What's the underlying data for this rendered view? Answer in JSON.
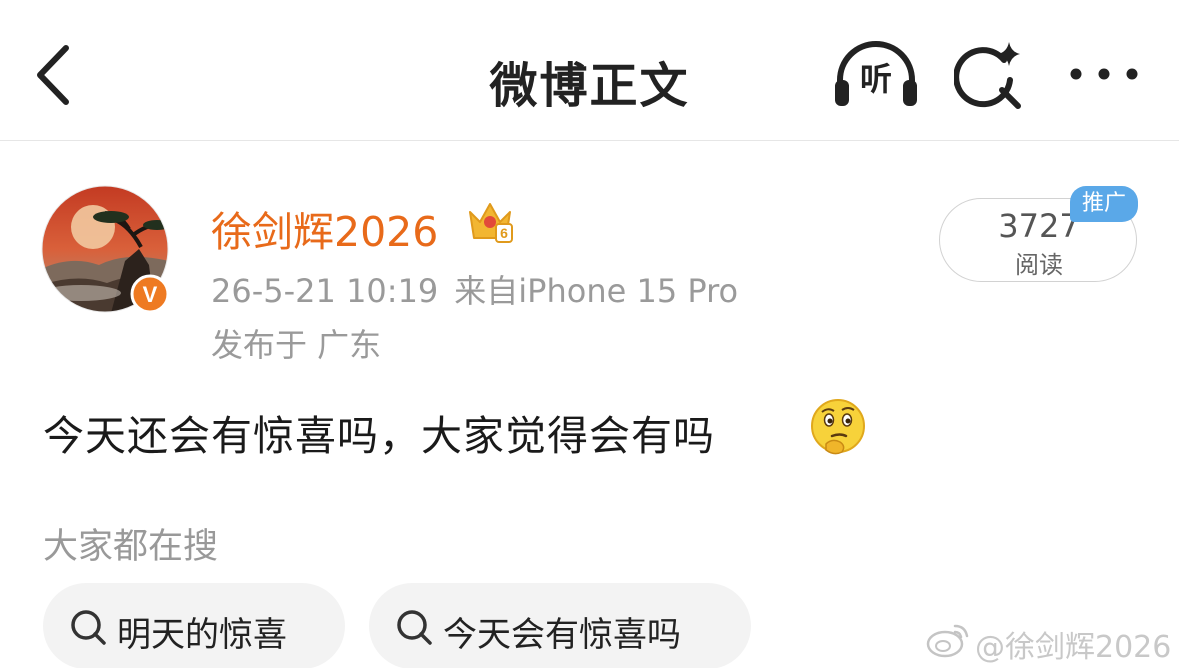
{
  "header": {
    "title": "微博正文",
    "back_icon": "chevron-left-icon",
    "listen_label": "听",
    "search_icon": "search-sparkle-icon",
    "more_icon": "more-dots-icon"
  },
  "post": {
    "author": {
      "name": "徐剑辉2026",
      "verified_badge": "V",
      "membership_badge": "crown-icon",
      "membership_level": "6"
    },
    "timestamp": "26-5-21 10:19",
    "source": "来自iPhone 15 Pro",
    "location": "发布于 广东",
    "read_count": "3727",
    "read_label": "阅读",
    "promo_badge": "推广",
    "text": "今天还会有惊喜吗，大家觉得会有吗",
    "emoji": "thinking-face-emoji"
  },
  "suggestions": {
    "label": "大家都在搜",
    "items": [
      {
        "text": "明天的惊喜",
        "icon": "search-icon"
      },
      {
        "text": "今天会有惊喜吗",
        "icon": "search-icon"
      }
    ]
  },
  "watermark": {
    "text": "@徐剑辉2026",
    "logo": "weibo-logo-icon"
  },
  "colors": {
    "username": "#e86a1a",
    "verified": "#ee7a22",
    "promo": "#5aa8e8",
    "meta": "#9a9a9a"
  }
}
